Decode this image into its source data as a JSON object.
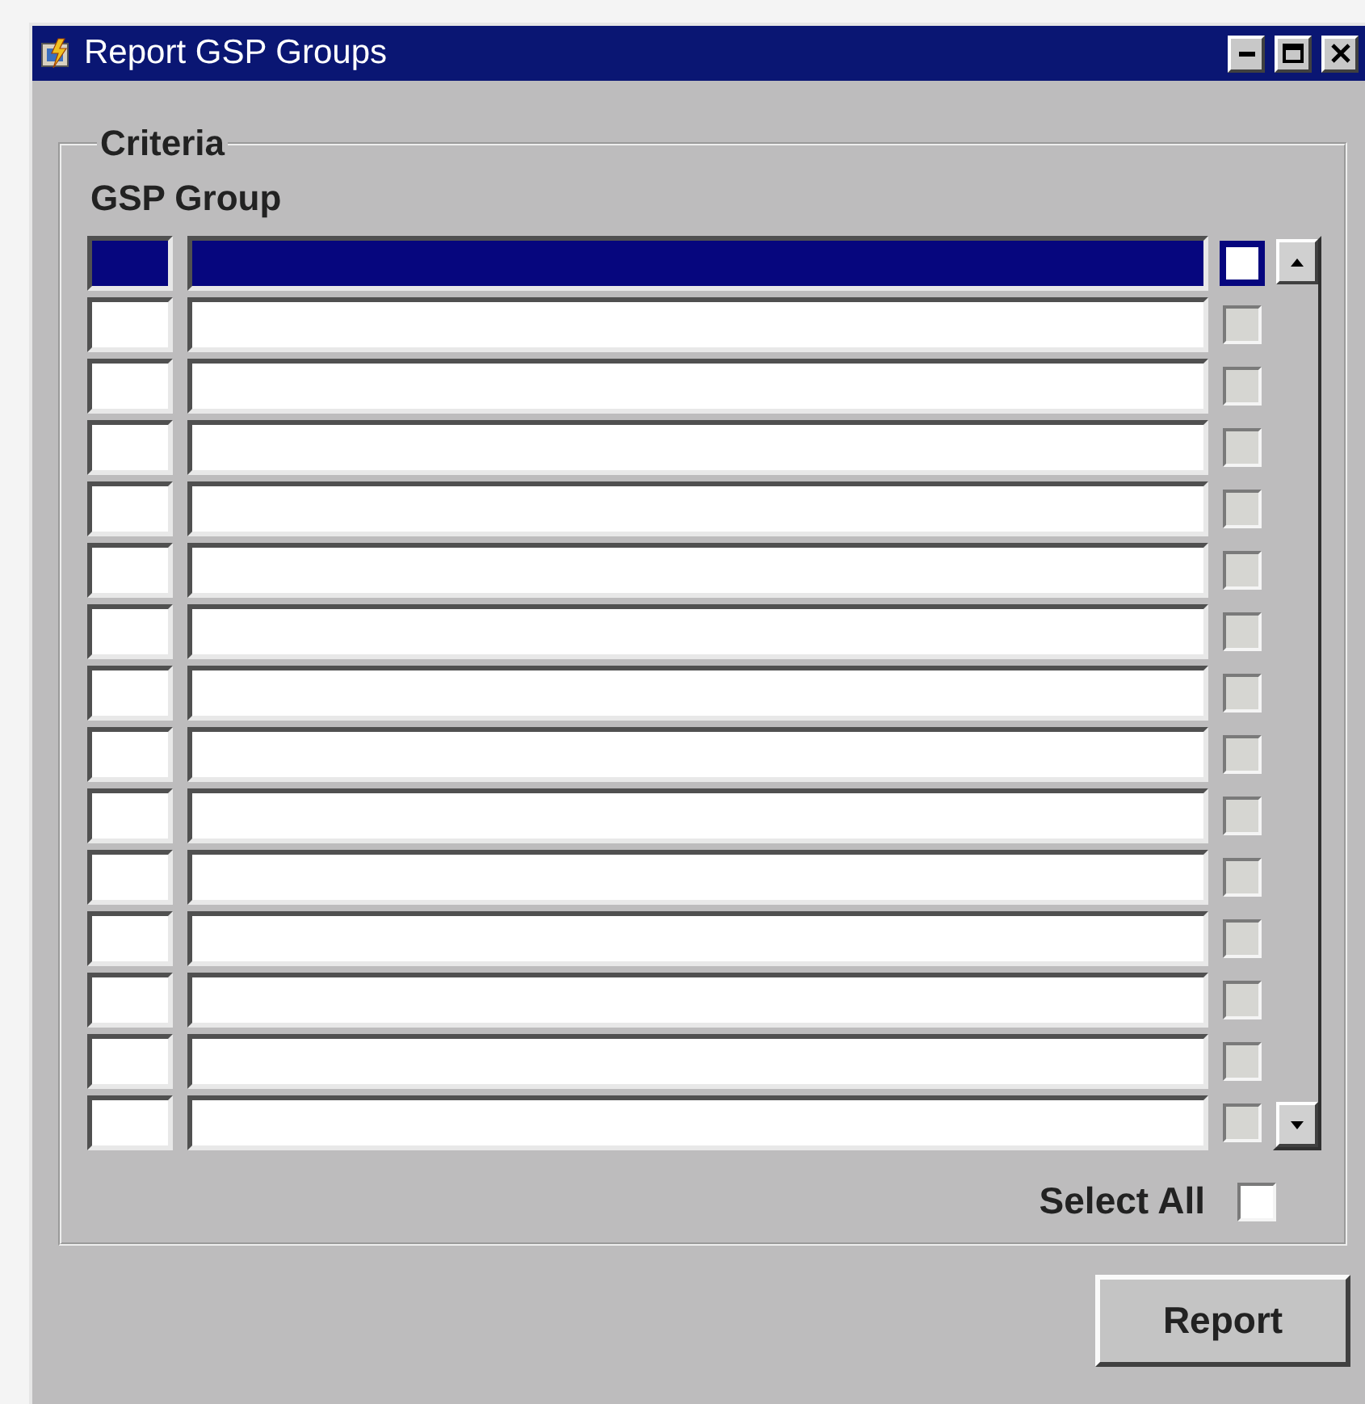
{
  "window": {
    "title": "Report GSP Groups"
  },
  "criteria": {
    "legend": "Criteria",
    "label": "GSP Group",
    "rows": [
      {
        "selected": true,
        "checked": false,
        "checkbox_disabled": false
      },
      {
        "selected": false,
        "checked": false,
        "checkbox_disabled": true
      },
      {
        "selected": false,
        "checked": false,
        "checkbox_disabled": true
      },
      {
        "selected": false,
        "checked": false,
        "checkbox_disabled": true
      },
      {
        "selected": false,
        "checked": false,
        "checkbox_disabled": true
      },
      {
        "selected": false,
        "checked": false,
        "checkbox_disabled": true
      },
      {
        "selected": false,
        "checked": false,
        "checkbox_disabled": true
      },
      {
        "selected": false,
        "checked": false,
        "checkbox_disabled": true
      },
      {
        "selected": false,
        "checked": false,
        "checkbox_disabled": true
      },
      {
        "selected": false,
        "checked": false,
        "checkbox_disabled": true
      },
      {
        "selected": false,
        "checked": false,
        "checkbox_disabled": true
      },
      {
        "selected": false,
        "checked": false,
        "checkbox_disabled": true
      },
      {
        "selected": false,
        "checked": false,
        "checkbox_disabled": true
      },
      {
        "selected": false,
        "checked": false,
        "checkbox_disabled": true
      },
      {
        "selected": false,
        "checked": false,
        "checkbox_disabled": true
      }
    ],
    "select_all": {
      "label": "Select All",
      "checked": false
    }
  },
  "buttons": [
    {
      "label": "Report"
    }
  ]
}
